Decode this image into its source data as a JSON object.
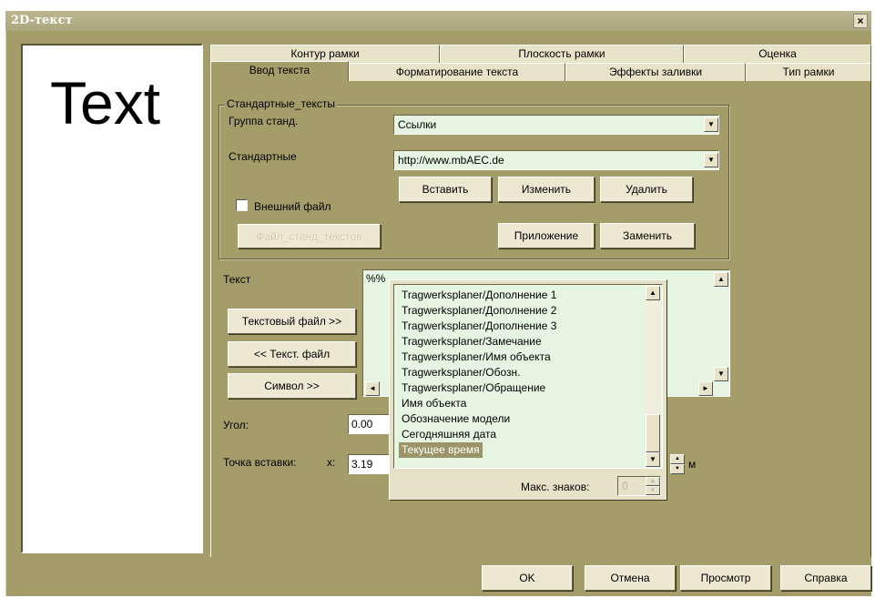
{
  "window": {
    "title": "2D-текст",
    "close_glyph": "×"
  },
  "preview": {
    "text": "Text"
  },
  "tabs_row1": [
    "Контур рамки",
    "Плоскость рамки",
    "Оценка"
  ],
  "tabs_row2": [
    "Ввод текста",
    "Форматирование текста",
    "Эффекты заливки",
    "Тип рамки"
  ],
  "standard_texts": {
    "group_title": "Стандартные_тексты",
    "group_label": "Группа станд.",
    "group_value": "Ссылки",
    "standard_label": "Стандартные",
    "standard_value": "http://www.mbAEC.de",
    "insert_button": "Вставить",
    "change_button": "Изменить",
    "delete_button": "Удалить",
    "external_file_label": "Внешний файл",
    "std_texts_file_button": "Файл_станд_текстов",
    "append_button": "Приложение",
    "replace_button": "Заменить"
  },
  "text_section": {
    "label": "Текст",
    "value": "%%",
    "text_file_button": "Текстовый файл >>",
    "text_file_back_button": "<< Текст. файл",
    "symbol_button": "Символ >>"
  },
  "angle": {
    "label": "Угол:",
    "value": "0.00"
  },
  "insert_point": {
    "label": "Точка вставки:",
    "x_label": "x:",
    "x_value": "3.19",
    "unit": "м"
  },
  "popup": {
    "items": [
      "Tragwerksplaner/Дополнение 1",
      "Tragwerksplaner/Дополнение 2",
      "Tragwerksplaner/Дополнение 3",
      "Tragwerksplaner/Замечание",
      "Tragwerksplaner/Имя объекта",
      "Tragwerksplaner/Обозн.",
      "Tragwerksplaner/Обращение",
      "Имя объекта",
      "Обозначение модели",
      "Сегодняшняя дата",
      "Текущее время"
    ],
    "max_chars_label": "Макс. знаков:",
    "max_chars_value": "0"
  },
  "footer": {
    "ok": "OK",
    "cancel": "Отмена",
    "preview": "Просмотр",
    "help": "Справка"
  }
}
